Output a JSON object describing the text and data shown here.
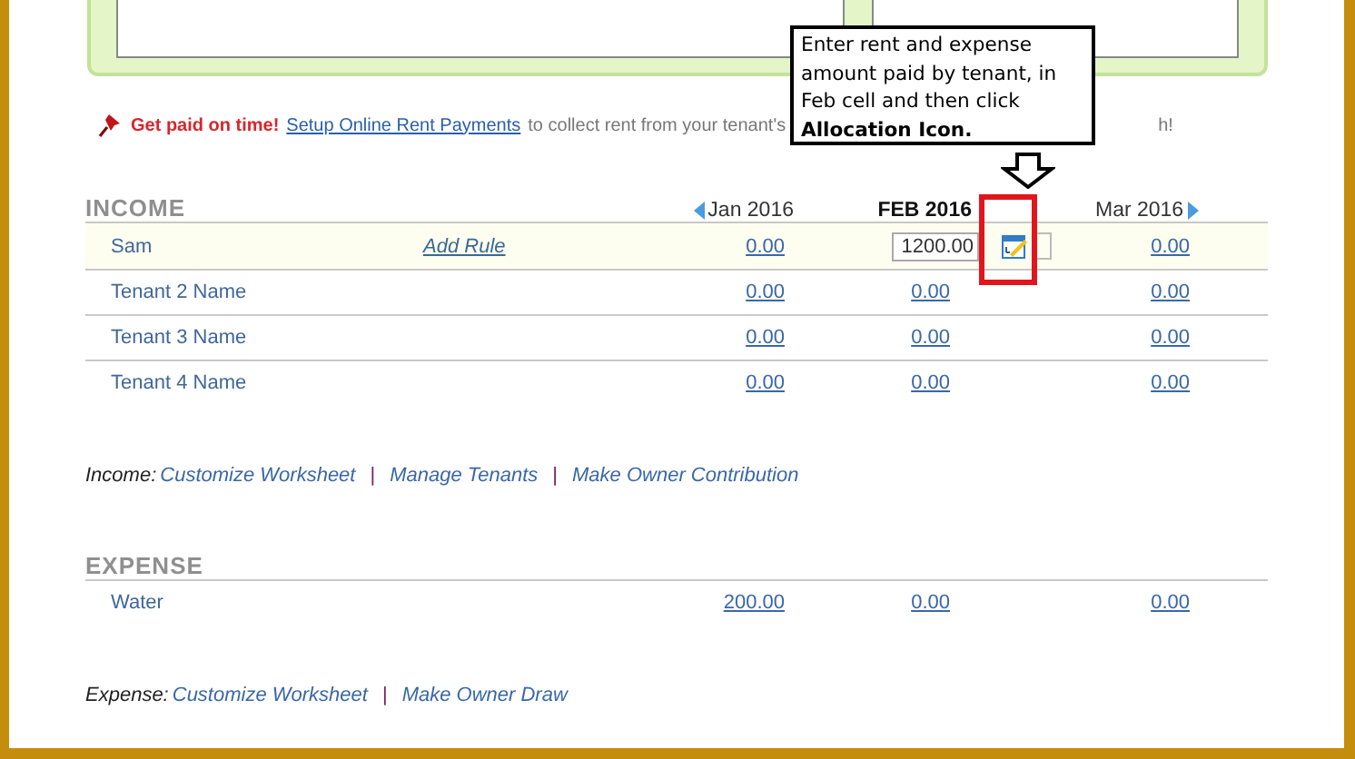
{
  "promo": {
    "headline": "Get paid on time!",
    "link": "Setup Online Rent Payments",
    "text": "to collect rent from your tenant's",
    "tail": "h!"
  },
  "callout": {
    "text": "Enter rent and expense amount paid by tenant, in Feb cell and then click **Allocation Icon.**"
  },
  "income": {
    "heading": "INCOME",
    "months": [
      {
        "label": "Jan 2016",
        "kind": "prev"
      },
      {
        "label": "FEB 2016",
        "kind": "current"
      },
      {
        "label": "Mar 2016",
        "kind": "next"
      }
    ],
    "rows": [
      {
        "name": "Sam",
        "rule": "Add Rule",
        "selected": true,
        "values": [
          {
            "kind": "link",
            "text": "0.00"
          },
          {
            "kind": "input",
            "text": "1200.00"
          },
          {
            "kind": "link",
            "text": "0.00"
          }
        ]
      },
      {
        "name": "Tenant 2 Name",
        "selected": false,
        "values": [
          {
            "kind": "link",
            "text": "0.00"
          },
          {
            "kind": "link",
            "text": "0.00"
          },
          {
            "kind": "link",
            "text": "0.00"
          }
        ]
      },
      {
        "name": "Tenant 3 Name",
        "selected": false,
        "values": [
          {
            "kind": "link",
            "text": "0.00"
          },
          {
            "kind": "link",
            "text": "0.00"
          },
          {
            "kind": "link",
            "text": "0.00"
          }
        ]
      },
      {
        "name": "Tenant 4 Name",
        "selected": false,
        "values": [
          {
            "kind": "link",
            "text": "0.00"
          },
          {
            "kind": "link",
            "text": "0.00"
          },
          {
            "kind": "link",
            "text": "0.00"
          }
        ]
      }
    ],
    "footer": {
      "label": "Income:",
      "separator": "|",
      "links": [
        "Customize Worksheet",
        "Manage Tenants",
        "Make Owner Contribution"
      ]
    }
  },
  "expense": {
    "heading": "EXPENSE",
    "rows": [
      {
        "name": "Water",
        "selected": false,
        "values": [
          {
            "kind": "link",
            "text": "200.00"
          },
          {
            "kind": "link",
            "text": "0.00"
          },
          {
            "kind": "link",
            "text": "0.00"
          }
        ]
      }
    ],
    "footer": {
      "label": "Expense:",
      "separator": "|",
      "links": [
        "Customize Worksheet",
        "Make Owner Draw"
      ]
    }
  }
}
